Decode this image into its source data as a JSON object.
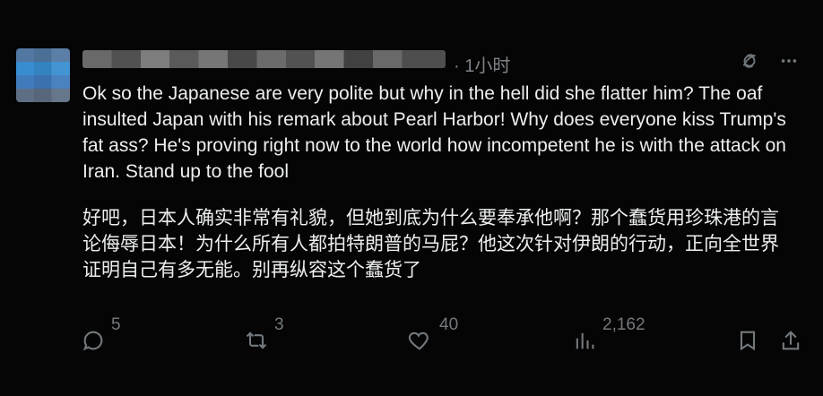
{
  "post": {
    "time": "· 1小时",
    "text_en": "Ok so the Japanese are very polite but why in the hell did she flatter him? The oaf insulted Japan with his remark about Pearl Harbor! Why does everyone kiss Trump's fat ass? He's proving right now to the world  how incompetent he is with the attack on Iran. Stand up to the fool",
    "text_cn": "好吧，日本人确实非常有礼貌，但她到底为什么要奉承他啊？那个蠢货用珍珠港的言论侮辱日本！为什么所有人都拍特朗普的马屁？他这次针对伊朗的行动，正向全世界证明自己有多无能。别再纵容这个蠢货了"
  },
  "actions": {
    "reply_count": "5",
    "repost_count": "3",
    "like_count": "40",
    "views_count": "2,162"
  },
  "icons": {
    "grok": "grok-icon",
    "more": "more-icon",
    "reply": "reply-icon",
    "repost": "repost-icon",
    "like": "heart-icon",
    "views": "views-icon",
    "bookmark": "bookmark-icon",
    "share": "share-icon"
  },
  "colors": {
    "background": "#000000",
    "text": "#e7e9ea",
    "muted": "#71767b"
  }
}
